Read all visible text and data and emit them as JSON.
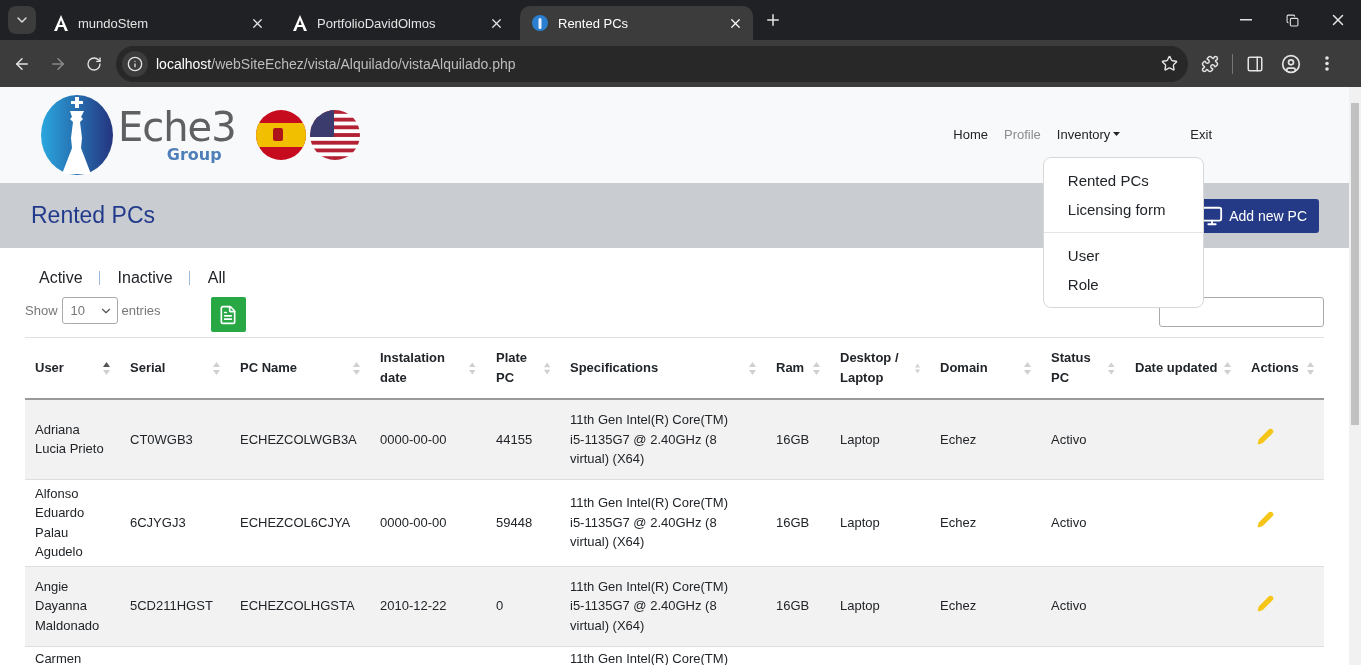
{
  "browser": {
    "tabs": [
      {
        "title": "mundoStem",
        "kind": "letter",
        "selected": false
      },
      {
        "title": "PortfolioDavidOlmos",
        "kind": "letter",
        "selected": false
      },
      {
        "title": "Rented PCs",
        "kind": "round",
        "selected": true
      }
    ],
    "url": {
      "host": "localhost",
      "path": "/webSiteEchez/vista/Alquilado/vistaAlquilado.php"
    }
  },
  "logo": {
    "word": "Eche3",
    "sub": "Group"
  },
  "nav": [
    {
      "label": "Home",
      "kind": "link",
      "disabled": false
    },
    {
      "label": "Profile",
      "kind": "link",
      "disabled": true
    },
    {
      "label": "Inventory",
      "kind": "dropdown",
      "disabled": false,
      "expanded": true
    },
    {
      "label": "Exit",
      "kind": "exit",
      "disabled": false
    }
  ],
  "dropdown_menu": {
    "groups": [
      [
        "Rented PCs",
        "Licensing form"
      ],
      [
        "User",
        "Role"
      ]
    ]
  },
  "page_title": "Rented PCs",
  "add_button": "Add new PC",
  "filters": [
    "Active",
    "Inactive",
    "All"
  ],
  "length_menu": {
    "prefix": "Show",
    "value": "10",
    "suffix": "entries"
  },
  "table": {
    "columns": [
      {
        "label": "User",
        "sorted": true
      },
      {
        "label": "Serial",
        "sorted": false
      },
      {
        "label": "PC Name",
        "sorted": false
      },
      {
        "label": "Instalation date",
        "sorted": false
      },
      {
        "label": "Plate PC",
        "sorted": false
      },
      {
        "label": "Specifications",
        "sorted": false
      },
      {
        "label": "Ram",
        "sorted": false
      },
      {
        "label": "Desktop / Laptop",
        "sorted": false
      },
      {
        "label": "Domain",
        "sorted": false
      },
      {
        "label": "Status PC",
        "sorted": false
      },
      {
        "label": "Date updated",
        "sorted": false
      },
      {
        "label": "Actions",
        "sorted": false
      }
    ],
    "rows": [
      {
        "kind": "full",
        "cells": [
          "Adriana Lucia Prieto",
          "CT0WGB3",
          "ECHEZCOLWGB3A",
          "0000-00-00",
          "44155",
          "11th Gen Intel(R) Core(TM) i5-1135G7 @ 2.40GHz (8 virtual) (X64)",
          "16GB",
          "Laptop",
          "Echez",
          "Activo"
        ]
      },
      {
        "kind": "full",
        "cells": [
          "Alfonso Eduardo Palau Agudelo",
          "6CJYGJ3",
          "ECHEZCOL6CJYA",
          "0000-00-00",
          "59448",
          "11th Gen Intel(R) Core(TM) i5-1135G7 @ 2.40GHz (8 virtual) (X64)",
          "16GB",
          "Laptop",
          "Echez",
          "Activo"
        ]
      },
      {
        "kind": "full",
        "cells": [
          "Angie Dayanna Maldonado",
          "5CD211HGST",
          "ECHEZCOLHGSTA",
          "2010-12-22",
          "0",
          "11th Gen Intel(R) Core(TM) i5-1135G7 @ 2.40GHz (8 virtual) (X64)",
          "16GB",
          "Laptop",
          "Echez",
          "Activo"
        ]
      },
      {
        "kind": "cut",
        "cells": [
          "Carmen",
          null,
          null,
          null,
          null,
          "11th Gen Intel(R) Core(TM)",
          null,
          null,
          null,
          null
        ]
      }
    ]
  }
}
